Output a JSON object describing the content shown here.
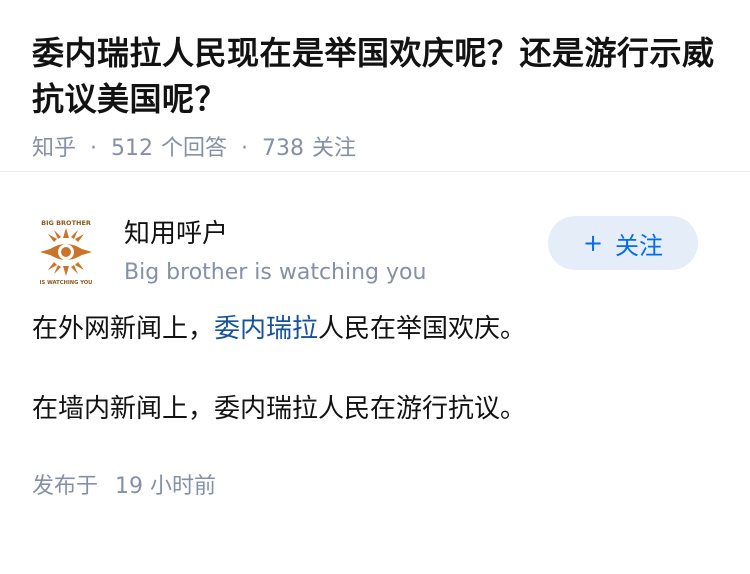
{
  "question": {
    "title": "委内瑞拉人民现在是举国欢庆呢？还是游行示威抗议美国呢？",
    "source": "知乎",
    "answer_count": "512",
    "answer_label": "个回答",
    "follower_count": "738",
    "follower_label": "关注"
  },
  "author": {
    "name": "知用呼户",
    "headline": "Big brother is watching you",
    "avatar_icon": "big-brother-eye-logo",
    "avatar_text_top": "BIG BROTHER",
    "avatar_text_bottom": "IS WATCHING YOU",
    "follow_label": "关注",
    "follow_plus": "+"
  },
  "answer": {
    "para1_prefix": "在外网新闻上，",
    "para1_link": "委内瑞拉",
    "para1_suffix": "人民在举国欢庆。",
    "para2": "在墙内新闻上，委内瑞拉人民在游行抗议。",
    "publish_label": "发布于",
    "publish_time": "19 小时前"
  },
  "colors": {
    "accent": "#056de8",
    "link": "#175199",
    "meta": "#8590a6",
    "avatar_orange": "#c8742a"
  }
}
